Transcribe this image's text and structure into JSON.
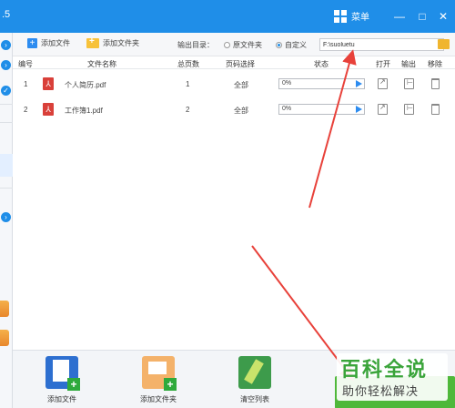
{
  "app": {
    "version_suffix": ".5",
    "menu_label": "菜单",
    "window_buttons": [
      "minimize",
      "maximize",
      "close"
    ]
  },
  "toolbar": {
    "add_file_label": "添加文件",
    "add_folder_label": "添加文件夹",
    "output_dir_label": "输出目录：",
    "radio_original": "原文件夹",
    "radio_custom": "自定义",
    "selected_output": "自定义",
    "output_path": "F:\\suoluetu"
  },
  "table": {
    "headers": [
      "编号",
      "文件名称",
      "总页数",
      "页码选择",
      "状态",
      "打开",
      "输出",
      "移除"
    ],
    "rows": [
      {
        "index": "1",
        "name": "个人简历.pdf",
        "pages": "1",
        "page_select": "全部",
        "status": "0%",
        "progress": 0
      },
      {
        "index": "2",
        "name": "工作簿1.pdf",
        "pages": "2",
        "page_select": "全部",
        "status": "0%",
        "progress": 0
      }
    ]
  },
  "bottombar": {
    "add_file_label": "添加文件",
    "add_folder_label": "添加文件夹",
    "clear_list_label": "清空列表"
  },
  "watermark": {
    "title": "百科全说",
    "subtitle": "助你轻松解决"
  },
  "colors": {
    "titlebar": "#1f8ee8",
    "accent": "#2d8cf0",
    "convert_button": "#4fb83a",
    "annotation_arrow": "#e8413a"
  }
}
